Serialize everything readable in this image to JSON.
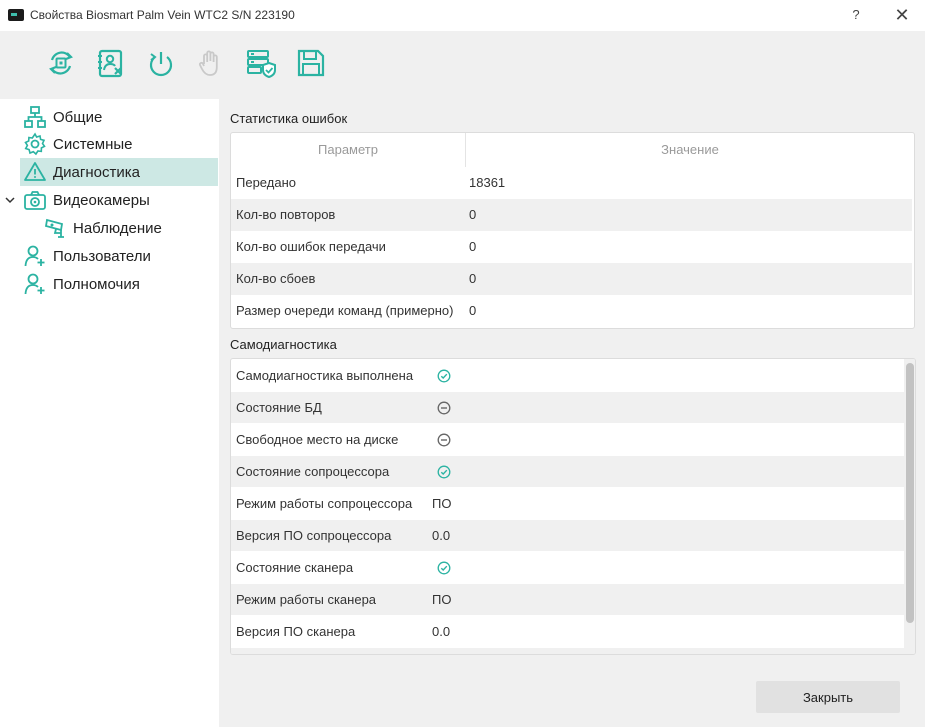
{
  "window": {
    "title": "Свойства Biosmart Palm Vein WTC2 S/N 223190",
    "help_label": "?",
    "close_label": "✕"
  },
  "toolbar": {
    "buttons": [
      {
        "icon": "refresh-chip-icon",
        "enabled": true
      },
      {
        "icon": "user-card-remove-icon",
        "enabled": true
      },
      {
        "icon": "power-restart-icon",
        "enabled": true
      },
      {
        "icon": "palm-hand-icon",
        "enabled": false
      },
      {
        "icon": "server-shield-icon",
        "enabled": true
      },
      {
        "icon": "save-floppy-icon",
        "enabled": true
      }
    ],
    "accent": "#2bb3a2"
  },
  "sidebar": {
    "items": [
      {
        "label": "Общие",
        "icon": "network-icon"
      },
      {
        "label": "Системные",
        "icon": "gear-icon"
      },
      {
        "label": "Диагностика",
        "icon": "warning-icon",
        "active": true
      },
      {
        "label": "Видеокамеры",
        "icon": "camera-icon",
        "expanded": true
      },
      {
        "label": "Наблюдение",
        "icon": "cctv-icon"
      },
      {
        "label": "Пользователи",
        "icon": "user-add-icon"
      },
      {
        "label": "Полномочия",
        "icon": "user-add-icon"
      }
    ]
  },
  "errors": {
    "title": "Статистика ошибок",
    "columns": [
      "Параметр",
      "Значение"
    ],
    "rows": [
      {
        "param": "Передано",
        "value": "18361"
      },
      {
        "param": "Кол-во повторов",
        "value": "0"
      },
      {
        "param": "Кол-во ошибок передачи",
        "value": "0"
      },
      {
        "param": "Кол-во сбоев",
        "value": "0"
      },
      {
        "param": "Размер очереди команд (примерно)",
        "value": "0"
      }
    ]
  },
  "selfdiag": {
    "title": "Самодиагностика",
    "rows": [
      {
        "param": "Самодиагностика выполнена",
        "state": "ok"
      },
      {
        "param": "Состояние БД",
        "state": "minus"
      },
      {
        "param": "Свободное место на диске",
        "state": "minus"
      },
      {
        "param": "Состояние сопроцессора",
        "state": "ok"
      },
      {
        "param": "Режим работы сопроцессора",
        "value": "ПО"
      },
      {
        "param": "Версия ПО сопроцессора",
        "value": "0.0"
      },
      {
        "param": "Состояние сканера",
        "state": "ok"
      },
      {
        "param": "Режим работы сканера",
        "value": "ПО"
      },
      {
        "param": "Версия ПО сканера",
        "value": "0.0"
      }
    ]
  },
  "footer": {
    "close_button": "Закрыть"
  },
  "colors": {
    "accent": "#2bb3a2",
    "active_bg": "#cde8e4",
    "ok": "#2bb3a2",
    "neutral": "#666666"
  }
}
